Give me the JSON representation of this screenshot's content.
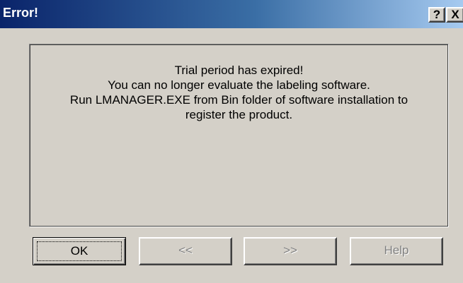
{
  "window": {
    "title": "Error!",
    "help_caption": "?",
    "close_caption": "X"
  },
  "message": {
    "lines": [
      "Trial period has expired!",
      "You can no longer evaluate the labeling software.",
      "Run LMANAGER.EXE from Bin folder of software installation to",
      "register the product."
    ]
  },
  "buttons": {
    "ok": "OK",
    "prev": "<<",
    "next": ">>",
    "help": "Help"
  },
  "colors": {
    "titlebar_start": "#0a246a",
    "titlebar_end": "#a6caf0",
    "face": "#d4d0c8",
    "disabled_text": "#808080"
  },
  "icons": [
    "help-icon",
    "close-icon"
  ]
}
